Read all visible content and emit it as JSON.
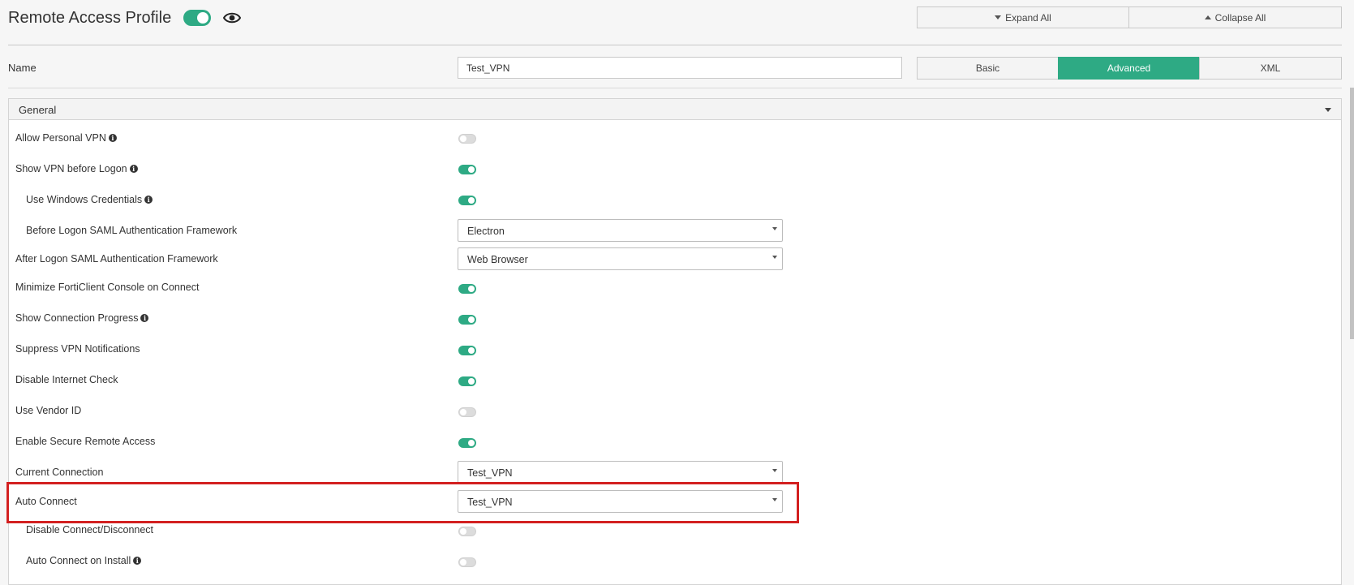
{
  "header": {
    "title": "Remote Access Profile",
    "profile_enabled": true,
    "expand_all": "Expand All",
    "collapse_all": "Collapse All"
  },
  "name_row": {
    "label": "Name",
    "value": "Test_VPN",
    "modes": [
      "Basic",
      "Advanced",
      "XML"
    ],
    "active_mode": "Advanced"
  },
  "panel": {
    "title": "General",
    "rows": [
      {
        "label": "Allow Personal VPN",
        "info": true,
        "type": "toggle",
        "on": false
      },
      {
        "label": "Show VPN before Logon",
        "info": true,
        "type": "toggle",
        "on": true
      },
      {
        "label": "Use Windows Credentials",
        "info": true,
        "type": "toggle",
        "on": true
      },
      {
        "label": "Before Logon SAML Authentication Framework",
        "type": "select",
        "value": "Electron"
      },
      {
        "label": "After Logon SAML Authentication Framework",
        "type": "select",
        "value": "Web Browser"
      },
      {
        "label": "Minimize FortiClient Console on Connect",
        "type": "toggle",
        "on": true
      },
      {
        "label": "Show Connection Progress",
        "info": true,
        "type": "toggle",
        "on": true
      },
      {
        "label": "Suppress VPN Notifications",
        "type": "toggle",
        "on": true
      },
      {
        "label": "Disable Internet Check",
        "type": "toggle",
        "on": true
      },
      {
        "label": "Use Vendor ID",
        "type": "toggle",
        "on": false
      },
      {
        "label": "Enable Secure Remote Access",
        "type": "toggle",
        "on": true
      },
      {
        "label": "Current Connection",
        "type": "select",
        "value": "Test_VPN"
      },
      {
        "label": "Auto Connect",
        "type": "select",
        "value": "Test_VPN"
      },
      {
        "label": "Disable Connect/Disconnect",
        "type": "toggle",
        "on": false
      },
      {
        "label": "Auto Connect on Install",
        "info": true,
        "type": "toggle",
        "on": false
      }
    ]
  },
  "colors": {
    "accent": "#2eaa84",
    "highlight": "#d32020"
  }
}
